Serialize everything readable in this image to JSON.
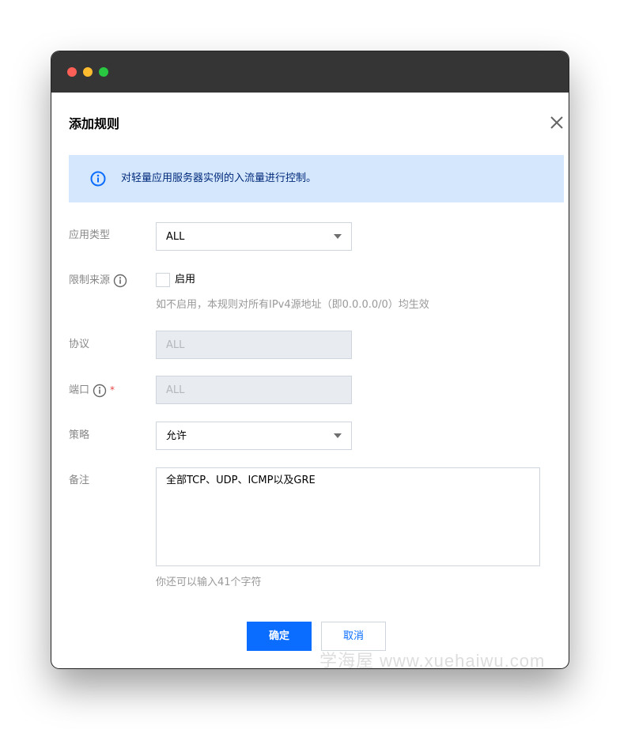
{
  "dialog": {
    "title": "添加规则",
    "info_text": "对轻量应用服务器实例的入流量进行控制。"
  },
  "form": {
    "app_type": {
      "label": "应用类型",
      "value": "ALL"
    },
    "source_limit": {
      "label": "限制来源",
      "checkbox_label": "启用",
      "checked": false,
      "hint": "如不启用，本规则对所有IPv4源地址（即0.0.0.0/0）均生效"
    },
    "protocol": {
      "label": "协议",
      "value": "ALL"
    },
    "port": {
      "label": "端口",
      "required_mark": "*",
      "value": "ALL"
    },
    "policy": {
      "label": "策略",
      "value": "允许"
    },
    "remark": {
      "label": "备注",
      "value": "全部TCP、UDP、ICMP以及GRE",
      "hint": "你还可以输入41个字符"
    }
  },
  "buttons": {
    "confirm": "确定",
    "cancel": "取消"
  },
  "watermark": "学海屋 www.xuehaiwu.com",
  "colors": {
    "primary": "#0a6dff",
    "banner_bg": "#d5e7fd",
    "titlebar": "#353535"
  }
}
